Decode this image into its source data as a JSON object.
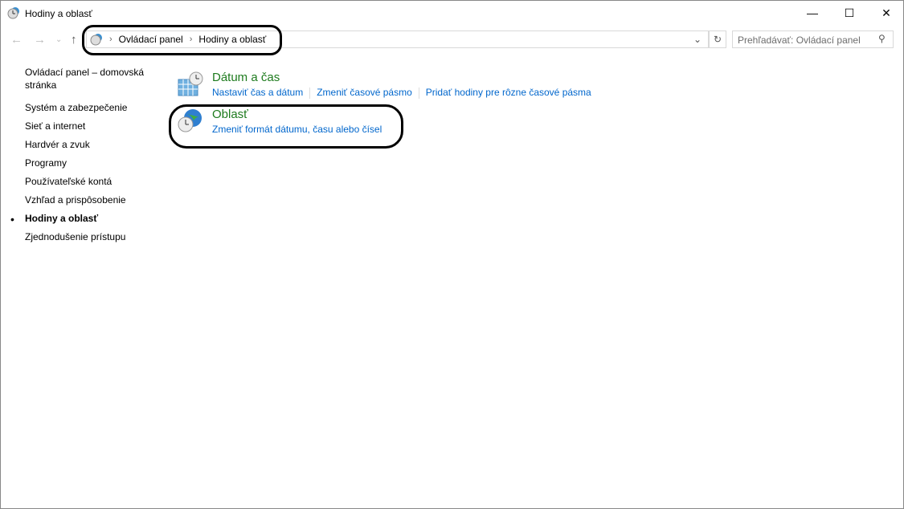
{
  "window": {
    "title": "Hodiny a oblasť",
    "icon": "clock-globe-icon"
  },
  "address": {
    "items": [
      "Ovládací panel",
      "Hodiny a oblasť"
    ]
  },
  "search": {
    "placeholder": "Prehľadávať: Ovládací panel"
  },
  "sidebar": {
    "home": "Ovládací panel – domovská stránka",
    "items": [
      {
        "label": "Systém a zabezpečenie"
      },
      {
        "label": "Sieť a internet"
      },
      {
        "label": "Hardvér a zvuk"
      },
      {
        "label": "Programy"
      },
      {
        "label": "Používateľské kontá"
      },
      {
        "label": "Vzhľad a prispôsobenie"
      },
      {
        "label": "Hodiny a oblasť",
        "active": true
      },
      {
        "label": "Zjednodušenie prístupu"
      }
    ]
  },
  "categories": [
    {
      "title": "Dátum a čas",
      "icon": "calendar-clock-icon",
      "links": [
        "Nastaviť čas a dátum",
        "Zmeniť časové pásmo",
        "Pridať hodiny pre rôzne časové pásma"
      ]
    },
    {
      "title": "Oblasť",
      "icon": "globe-clock-icon",
      "links": [
        "Zmeniť formát dátumu, času alebo čísel"
      ]
    }
  ],
  "colors": {
    "category": "#1e7b1e",
    "link": "#0066cc"
  }
}
